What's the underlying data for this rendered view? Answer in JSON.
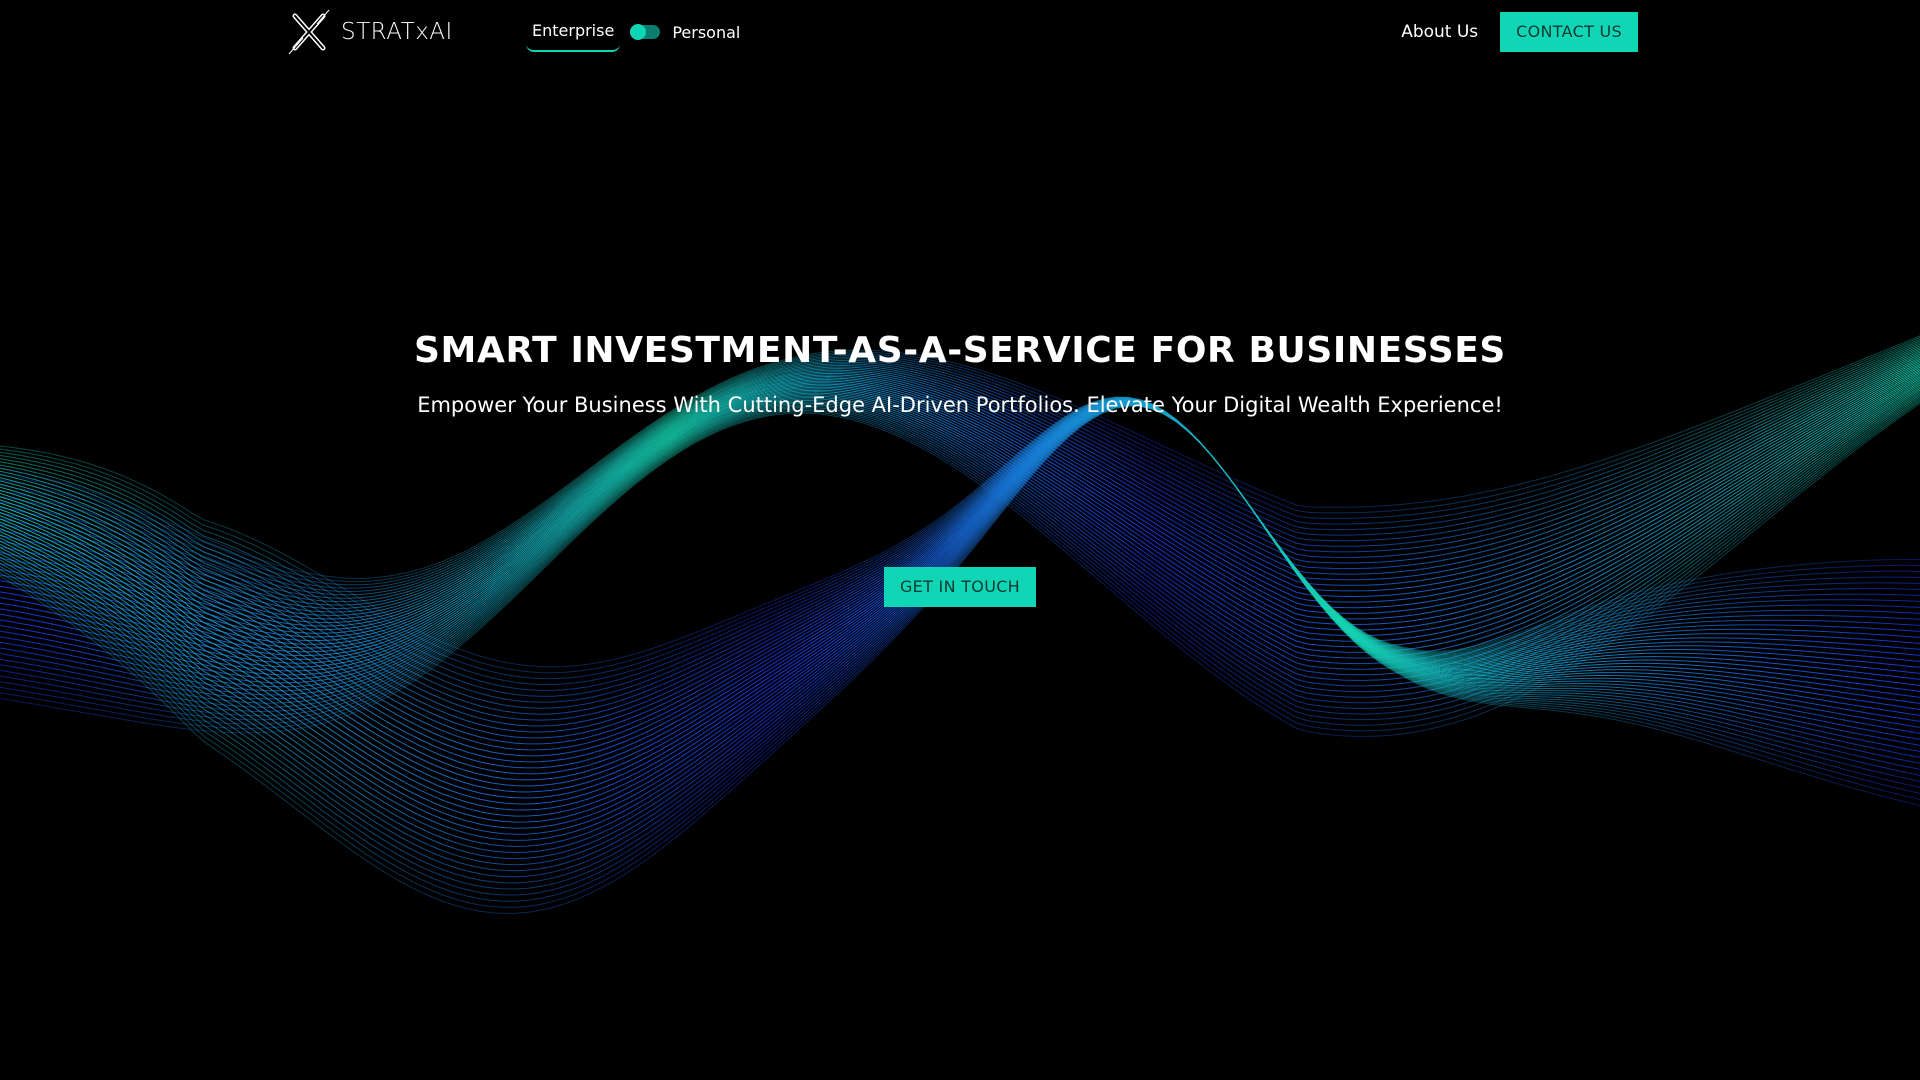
{
  "header": {
    "logo_text": "STRATxAI",
    "mode_toggle": {
      "left_label": "Enterprise",
      "right_label": "Personal",
      "selected": "Enterprise"
    },
    "nav": {
      "about_label": "About Us",
      "contact_label": "CONTACT US"
    }
  },
  "hero": {
    "title": "SMART INVESTMENT-AS-A-SERVICE FOR BUSINESSES",
    "subtitle": "Empower Your Business With Cutting-Edge AI-Driven Portfolios. Elevate Your Digital Wealth Experience!",
    "cta_label": "GET IN TOUCH"
  },
  "theme": {
    "background": "#000000",
    "accent": "#11d6b6",
    "wave_blue": "#1a3bff",
    "wave_teal": "#14d3b0"
  }
}
